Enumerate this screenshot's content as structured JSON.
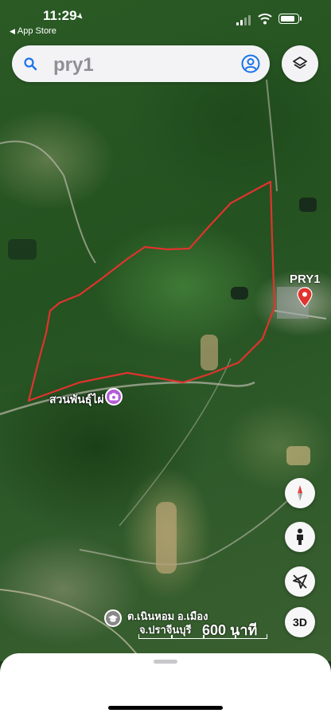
{
  "status_bar": {
    "time": "11:29",
    "back_app": "App Store"
  },
  "search": {
    "query": "pry1",
    "icon": "search-icon",
    "account_icon": "account-icon"
  },
  "map": {
    "pinned_place": "PRY1",
    "place_label": "สวนพันธุ์ไผ่",
    "address_line1": "ต.เนินหอม อ.เมือง",
    "address_line2": "จ.ปราจีนบุรี",
    "scale_label": "600 นาที",
    "boundary_color": "#e0332e",
    "pin_color": "#e0332e",
    "poi_color": "#b45cd6"
  },
  "controls": {
    "three_d_label": "3D"
  }
}
